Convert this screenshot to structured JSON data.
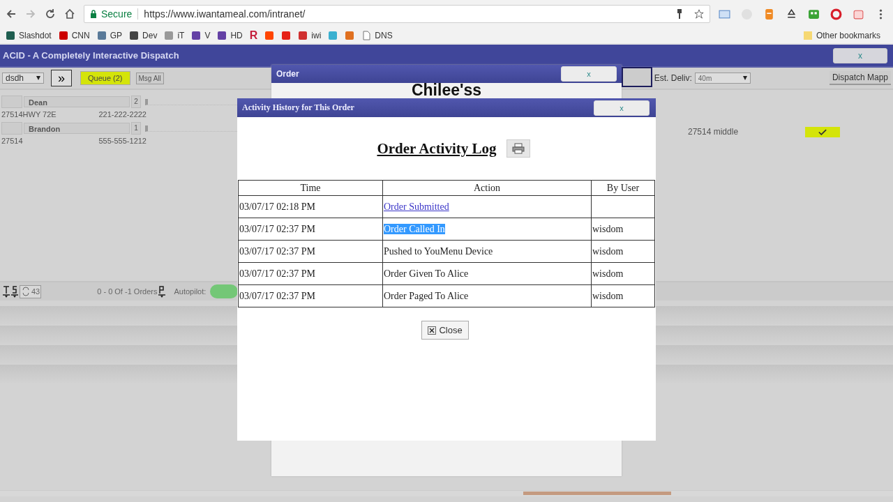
{
  "browser": {
    "secure_label": "Secure",
    "url": "https://www.iwantameal.com/intranet/",
    "bookmarks": [
      {
        "label": "Slashdot",
        "color": "#1f5e50"
      },
      {
        "label": "CNN",
        "color": "#cc0000"
      },
      {
        "label": "GP",
        "color": "#5a7a99"
      },
      {
        "label": "Dev",
        "color": "#444444"
      },
      {
        "label": "iT",
        "color": "#999999"
      },
      {
        "label": "V",
        "color": "#6441a5"
      },
      {
        "label": "HD",
        "color": "#6441a5"
      },
      {
        "label": "R",
        "color": "#c41e3a",
        "kind": "glyph"
      },
      {
        "color": "#ff4500"
      },
      {
        "color": "#e62117"
      },
      {
        "label": "iwi",
        "color": "#d03030"
      },
      {
        "color": "#3ab0d0"
      },
      {
        "color": "#e07020"
      },
      {
        "label": "DNS",
        "kind": "page"
      }
    ],
    "other_bookmarks": "Other bookmarks"
  },
  "app": {
    "title": "ACID - A Completely Interactive Dispatch",
    "close": "x",
    "toolbar": {
      "dispatcher": "dsdh",
      "forward": "»",
      "queue": "Queue (2)",
      "msg_all": "Msg All",
      "est_deliv_label": "Est. Deliv:",
      "est_deliv": "40m",
      "dispatch_map": "Dispatch Mapp"
    },
    "drivers": [
      {
        "name": "Dean",
        "count": "2",
        "address": "27514HWY 72E",
        "phone": "221-222-2222"
      },
      {
        "name": "Brandon",
        "count": "1",
        "address": "27514",
        "phone": "555-555-1212"
      }
    ],
    "order_row": {
      "address": "27514 middle",
      "checked": true
    },
    "status_bar": {
      "count": "43",
      "orders": "0 - 0 Of -1 Orders",
      "autopilot_label": "Autopilot:",
      "autopilot_on": true
    }
  },
  "order_dialog": {
    "title": "Order",
    "close": "x",
    "heading": "Chilee'ss"
  },
  "activity_dialog": {
    "title": "Activity History for This Order",
    "close": "x",
    "heading": "Order Activity Log",
    "table": {
      "columns": [
        "Time",
        "Action",
        "By User"
      ],
      "rows": [
        {
          "time": "03/07/17 02:18 PM",
          "action": "Order Submitted",
          "kind": "link",
          "highlighted": false
        },
        {
          "time": "03/07/17 02:37 PM",
          "action": "Order Called In",
          "kind": "text",
          "user": "wisdom",
          "highlighted": true
        },
        {
          "time": "03/07/17 02:37 PM",
          "action": "Pushed to YouMenu Device",
          "kind": "text",
          "user": "wisdom",
          "highlighted": false
        },
        {
          "time": "03/07/17 02:37 PM",
          "action": "Order Given To Alice",
          "kind": "text",
          "user": "wisdom",
          "highlighted": false
        },
        {
          "time": "03/07/17 02:37 PM",
          "action": "Order Paged To Alice",
          "kind": "text",
          "user": "wisdom",
          "highlighted": false
        }
      ]
    },
    "close_button": "Close"
  }
}
